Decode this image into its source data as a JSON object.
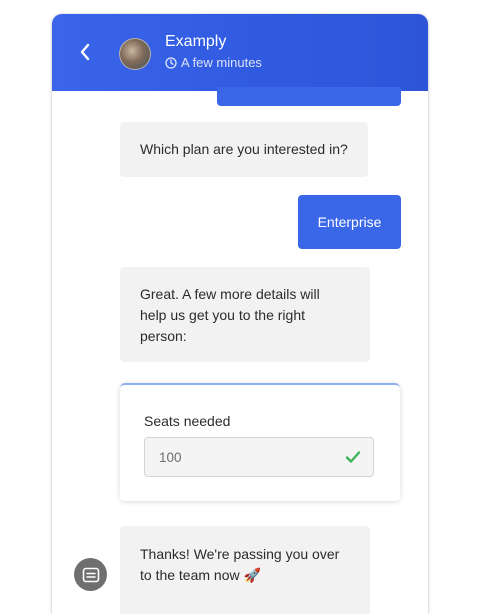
{
  "header": {
    "title": "Examply",
    "subtitle": "A few minutes"
  },
  "messages": {
    "question": "Which plan are you interested in?",
    "answer": "Enterprise",
    "followup": "Great. A few more details will help us get you to the right person:",
    "handoff": "Thanks! We're passing you over to the team now 🚀"
  },
  "form": {
    "label": "Seats needed",
    "value": "100"
  },
  "colors": {
    "header": "#2f5adf",
    "user_bubble": "#3a66e8",
    "bot_bubble": "#f2f2f2",
    "valid_check": "#3db45a"
  },
  "icons": {
    "back": "chevron-left-icon",
    "time": "clock-icon",
    "valid": "check-icon",
    "launcher": "chat-icon"
  }
}
